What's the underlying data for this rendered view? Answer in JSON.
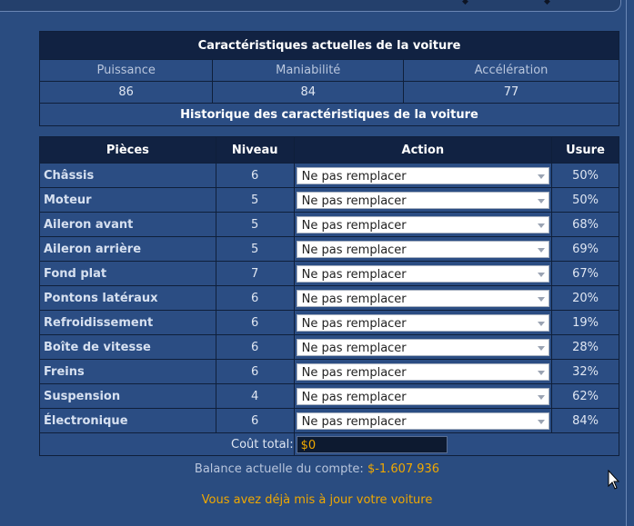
{
  "stats": {
    "title": "Caractéristiques actuelles de la voiture",
    "labels": [
      "Puissance",
      "Maniabilité",
      "Accélération"
    ],
    "values": [
      "86",
      "84",
      "77"
    ],
    "history_link": "Historique des caractéristiques de la voiture"
  },
  "parts_table": {
    "headers": {
      "piece": "Pièces",
      "level": "Niveau",
      "action": "Action",
      "wear": "Usure"
    },
    "rows": [
      {
        "name": "Châssis",
        "level": "6",
        "action": "Ne pas remplacer",
        "wear": "50%"
      },
      {
        "name": "Moteur",
        "level": "5",
        "action": "Ne pas remplacer",
        "wear": "50%"
      },
      {
        "name": "Aileron avant",
        "level": "5",
        "action": "Ne pas remplacer",
        "wear": "68%"
      },
      {
        "name": "Aileron arrière",
        "level": "5",
        "action": "Ne pas remplacer",
        "wear": "69%"
      },
      {
        "name": "Fond plat",
        "level": "7",
        "action": "Ne pas remplacer",
        "wear": "67%"
      },
      {
        "name": "Pontons latéraux",
        "level": "6",
        "action": "Ne pas remplacer",
        "wear": "20%"
      },
      {
        "name": "Refroidissement",
        "level": "6",
        "action": "Ne pas remplacer",
        "wear": "19%"
      },
      {
        "name": "Boîte de vitesse",
        "level": "6",
        "action": "Ne pas remplacer",
        "wear": "28%"
      },
      {
        "name": "Freins",
        "level": "6",
        "action": "Ne pas remplacer",
        "wear": "32%"
      },
      {
        "name": "Suspension",
        "level": "4",
        "action": "Ne pas remplacer",
        "wear": "62%"
      },
      {
        "name": "Électronique",
        "level": "6",
        "action": "Ne pas remplacer",
        "wear": "84%"
      }
    ],
    "total_label": "Coût total:",
    "total_value": "$0"
  },
  "footer": {
    "balance_label": "Balance actuelle du compte:",
    "balance_value": "$-1.607.936",
    "notice": "Vous avez déjà mis à jour votre voiture"
  },
  "icons": [
    "dropdown-arrow-icon",
    "mouse-cursor-icon"
  ],
  "colors": {
    "background": "#2a4c80",
    "header": "#112242",
    "accent": "#f0a800"
  }
}
